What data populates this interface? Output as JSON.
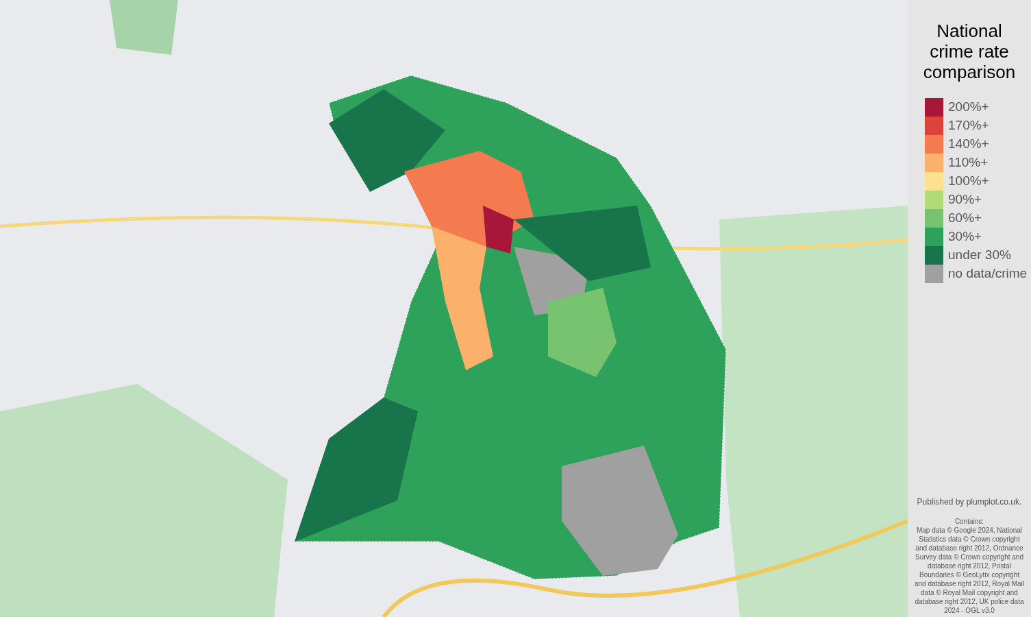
{
  "legend": {
    "title": "National crime rate comparison",
    "items": [
      {
        "label": "200%+",
        "color": "#a8173a"
      },
      {
        "label": "170%+",
        "color": "#dc443b"
      },
      {
        "label": "140%+",
        "color": "#f47a50"
      },
      {
        "label": "110%+",
        "color": "#fbb06b"
      },
      {
        "label": "100%+",
        "color": "#fde190"
      },
      {
        "label": "90%+",
        "color": "#b0db76"
      },
      {
        "label": "60%+",
        "color": "#77c36f"
      },
      {
        "label": "30%+",
        "color": "#2ea15b"
      },
      {
        "label": "under 30%",
        "color": "#18744a"
      },
      {
        "label": "no data/crime",
        "color": "#a0a0a0"
      }
    ]
  },
  "credits": {
    "publisher": "Published by plumplot.co.uk.",
    "heading": "Contains:",
    "text": "Map data © Google 2024, National Statistics data © Crown copyright and database right 2012, Ordnance Survey data © Crown copyright and database right 2012, Postal Boundaries © GeoLytix copyright and database right 2012, Royal Mail data © Royal Mail copyright and database right 2012, UK police data 2024 - OGL v3.0"
  }
}
